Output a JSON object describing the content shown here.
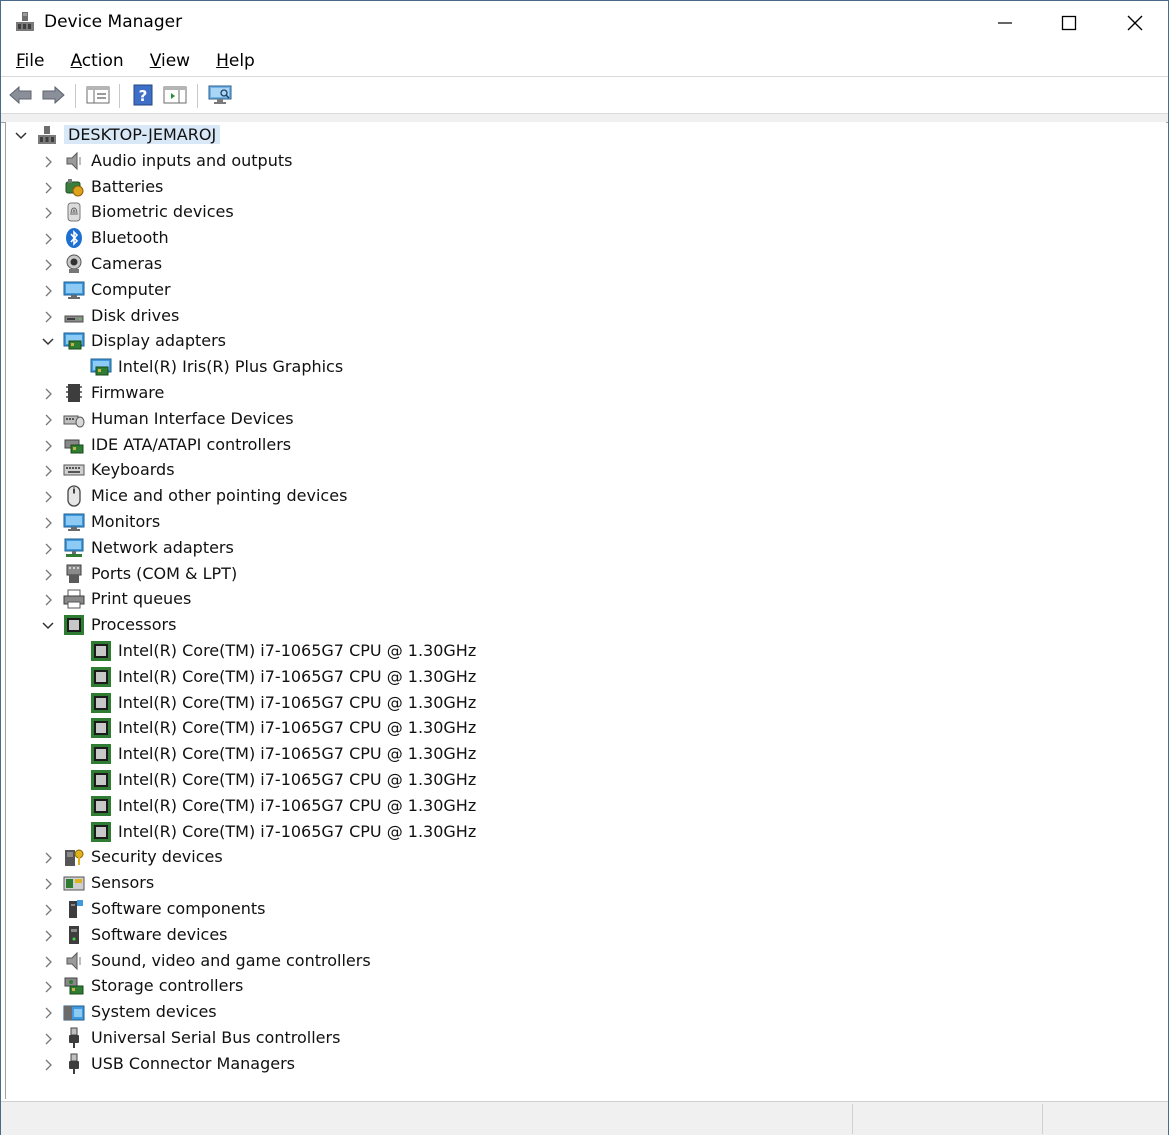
{
  "window": {
    "title": "Device Manager"
  },
  "menu": [
    {
      "label": "File"
    },
    {
      "label": "Action"
    },
    {
      "label": "View"
    },
    {
      "label": "Help"
    }
  ],
  "toolbar": {
    "icons": [
      "back-arrow-icon",
      "forward-arrow-icon",
      "properties-icon",
      "help-icon",
      "show-hide-console-tree-icon",
      "scan-hardware-icon"
    ]
  },
  "tree": {
    "root": "DESKTOP-JEMAROJ",
    "items": [
      {
        "label": "Audio inputs and outputs",
        "icon": "speaker-icon",
        "expanded": false
      },
      {
        "label": "Batteries",
        "icon": "battery-icon",
        "expanded": false
      },
      {
        "label": "Biometric devices",
        "icon": "fingerprint-icon",
        "expanded": false
      },
      {
        "label": "Bluetooth",
        "icon": "bluetooth-icon",
        "expanded": false
      },
      {
        "label": "Cameras",
        "icon": "camera-icon",
        "expanded": false
      },
      {
        "label": "Computer",
        "icon": "monitor-icon",
        "expanded": false
      },
      {
        "label": "Disk drives",
        "icon": "disk-drive-icon",
        "expanded": false
      },
      {
        "label": "Display adapters",
        "icon": "display-adapter-icon",
        "expanded": true,
        "children": [
          "Intel(R) Iris(R) Plus Graphics"
        ]
      },
      {
        "label": "Firmware",
        "icon": "firmware-icon",
        "expanded": false
      },
      {
        "label": "Human Interface Devices",
        "icon": "hid-icon",
        "expanded": false
      },
      {
        "label": "IDE ATA/ATAPI controllers",
        "icon": "ide-controller-icon",
        "expanded": false
      },
      {
        "label": "Keyboards",
        "icon": "keyboard-icon",
        "expanded": false
      },
      {
        "label": "Mice and other pointing devices",
        "icon": "mouse-icon",
        "expanded": false
      },
      {
        "label": "Monitors",
        "icon": "monitor-icon",
        "expanded": false
      },
      {
        "label": "Network adapters",
        "icon": "network-adapter-icon",
        "expanded": false
      },
      {
        "label": "Ports (COM & LPT)",
        "icon": "port-icon",
        "expanded": false
      },
      {
        "label": "Print queues",
        "icon": "printer-icon",
        "expanded": false
      },
      {
        "label": "Processors",
        "icon": "processor-icon",
        "expanded": true,
        "children": [
          "Intel(R) Core(TM) i7-1065G7 CPU @ 1.30GHz",
          "Intel(R) Core(TM) i7-1065G7 CPU @ 1.30GHz",
          "Intel(R) Core(TM) i7-1065G7 CPU @ 1.30GHz",
          "Intel(R) Core(TM) i7-1065G7 CPU @ 1.30GHz",
          "Intel(R) Core(TM) i7-1065G7 CPU @ 1.30GHz",
          "Intel(R) Core(TM) i7-1065G7 CPU @ 1.30GHz",
          "Intel(R) Core(TM) i7-1065G7 CPU @ 1.30GHz",
          "Intel(R) Core(TM) i7-1065G7 CPU @ 1.30GHz"
        ]
      },
      {
        "label": "Security devices",
        "icon": "security-key-icon",
        "expanded": false
      },
      {
        "label": "Sensors",
        "icon": "sensor-icon",
        "expanded": false
      },
      {
        "label": "Software components",
        "icon": "software-component-icon",
        "expanded": false
      },
      {
        "label": "Software devices",
        "icon": "software-device-icon",
        "expanded": false
      },
      {
        "label": "Sound, video and game controllers",
        "icon": "speaker-icon",
        "expanded": false
      },
      {
        "label": "Storage controllers",
        "icon": "storage-controller-icon",
        "expanded": false
      },
      {
        "label": "System devices",
        "icon": "system-devices-icon",
        "expanded": false
      },
      {
        "label": "Universal Serial Bus controllers",
        "icon": "usb-icon",
        "expanded": false
      },
      {
        "label": "USB Connector Managers",
        "icon": "usb-icon",
        "expanded": false
      }
    ]
  },
  "colors": {
    "selection": "#d9e8f7",
    "accent": "#0078d7",
    "chip_green": "#2e7d32"
  }
}
